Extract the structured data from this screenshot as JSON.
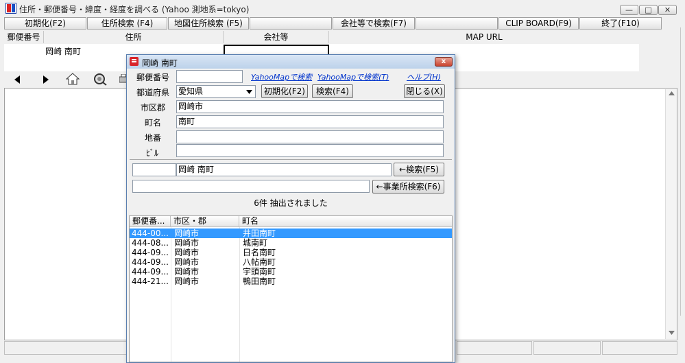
{
  "window": {
    "title": "住所・郵便番号・緯度・経度を調べる (Yahoo 測地系=tokyo)",
    "controls": [
      "—",
      "□",
      "✕"
    ]
  },
  "toolbar": {
    "init_label": "初期化(F2)",
    "address_search_label": "住所検索 (F4)",
    "map_search_label": "地図住所検索 (F5)",
    "company_search_label": "会社等で検索(F7)",
    "clipboard_label": "CLIP BOARD(F9)",
    "exit_label": "終了(F10)"
  },
  "columns": {
    "postal": "郵便番号",
    "address": "住所",
    "company": "会社等",
    "map_url": "MAP URL"
  },
  "result": {
    "address": "岡崎 南町"
  },
  "dialog": {
    "title": "岡崎 南町",
    "close_glyph": "x",
    "labels": {
      "postal": "郵便番号",
      "prefecture": "都道府県",
      "city": "市区郡",
      "town": "町名",
      "lot": "地番",
      "building": "ﾋﾞﾙ"
    },
    "fields": {
      "postal": "",
      "prefecture": "愛知県",
      "city": "岡崎市",
      "town": "南町",
      "lot": "",
      "building": "",
      "search_postal": "",
      "search_address": "岡崎 南町",
      "office_search": ""
    },
    "links": {
      "yahoo_map_1": "YahooMapで検索",
      "yahoo_map_2": "YahooMapで検索(T)",
      "help": "ヘルプ(H)"
    },
    "buttons": {
      "init": "初期化(F2)",
      "search": "検索(F4)",
      "close": "閉じる(X)",
      "search_f5": "←検索(F5)",
      "office_search": "←事業所検索(F6)"
    },
    "status": "6件 抽出されました",
    "list": {
      "headers": [
        "郵便番...",
        "市区・郡",
        "町名"
      ],
      "rows": [
        {
          "postal": "444-00...",
          "city": "岡崎市",
          "town": "井田南町",
          "selected": true
        },
        {
          "postal": "444-08...",
          "city": "岡崎市",
          "town": "城南町"
        },
        {
          "postal": "444-09...",
          "city": "岡崎市",
          "town": "日名南町"
        },
        {
          "postal": "444-09...",
          "city": "岡崎市",
          "town": "八帖南町"
        },
        {
          "postal": "444-09...",
          "city": "岡崎市",
          "town": "宇頭南町"
        },
        {
          "postal": "444-21...",
          "city": "岡崎市",
          "town": "鴨田南町"
        }
      ]
    }
  },
  "icons": [
    "back-arrow-icon",
    "forward-arrow-icon",
    "home-icon",
    "search-globe-icon",
    "print-icon"
  ]
}
